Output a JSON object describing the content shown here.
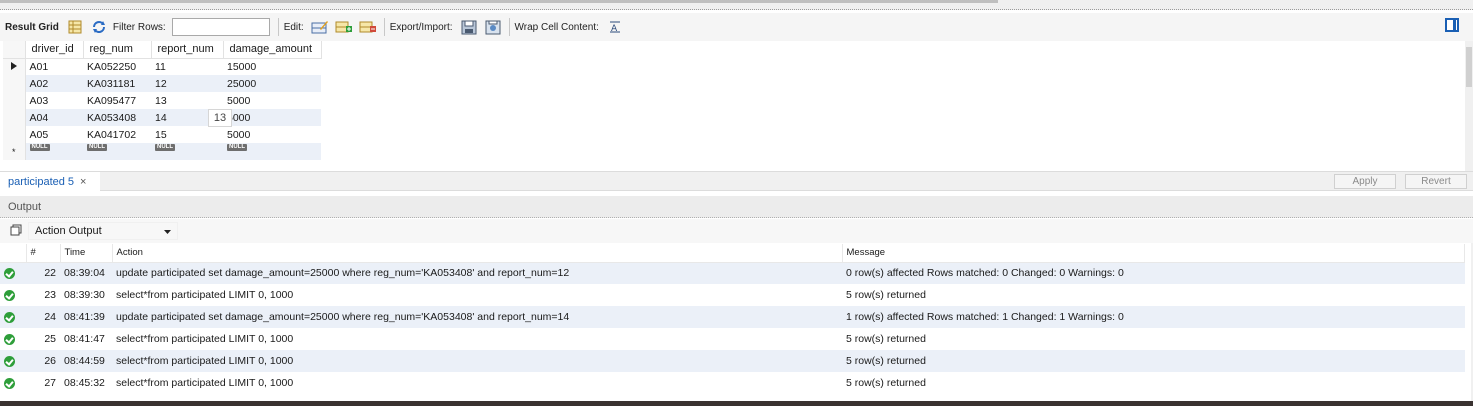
{
  "toolbar": {
    "result_grid_label": "Result Grid",
    "filter_rows_label": "Filter Rows:",
    "filter_rows_value": "",
    "edit_label": "Edit:",
    "export_import_label": "Export/Import:",
    "wrap_cell_label": "Wrap Cell Content:"
  },
  "grid": {
    "columns": [
      "driver_id",
      "reg_num",
      "report_num",
      "damage_amount"
    ],
    "rows": [
      {
        "driver_id": "A01",
        "reg_num": "KA052250",
        "report_num": "11",
        "damage_amount": "15000"
      },
      {
        "driver_id": "A02",
        "reg_num": "KA031181",
        "report_num": "12",
        "damage_amount": "25000"
      },
      {
        "driver_id": "A03",
        "reg_num": "KA095477",
        "report_num": "13",
        "damage_amount": "5000"
      },
      {
        "driver_id": "A04",
        "reg_num": "KA053408",
        "report_num": "14",
        "damage_amount": "5000"
      },
      {
        "driver_id": "A05",
        "reg_num": "KA041702",
        "report_num": "15",
        "damage_amount": "5000"
      }
    ],
    "null_label": "NULL",
    "new_row_marker": "*",
    "tooltip_value": "13"
  },
  "tab": {
    "label": "participated 5",
    "close": "×"
  },
  "buttons": {
    "apply": "Apply",
    "revert": "Revert"
  },
  "output": {
    "title": "Output",
    "selector_value": "Action Output",
    "columns": {
      "num": "#",
      "time": "Time",
      "action": "Action",
      "message": "Message"
    },
    "rows": [
      {
        "num": "22",
        "time": "08:39:04",
        "action": "update participated set damage_amount=25000 where reg_num='KA053408' and report_num=12",
        "message": "0 row(s) affected Rows matched: 0  Changed: 0  Warnings: 0"
      },
      {
        "num": "23",
        "time": "08:39:30",
        "action": "select*from participated LIMIT 0, 1000",
        "message": "5 row(s) returned"
      },
      {
        "num": "24",
        "time": "08:41:39",
        "action": "update participated set damage_amount=25000 where reg_num='KA053408' and report_num=14",
        "message": "1 row(s) affected Rows matched: 1  Changed: 1  Warnings: 0"
      },
      {
        "num": "25",
        "time": "08:41:47",
        "action": "select*from participated LIMIT 0, 1000",
        "message": "5 row(s) returned"
      },
      {
        "num": "26",
        "time": "08:44:59",
        "action": "select*from participated LIMIT 0, 1000",
        "message": "5 row(s) returned"
      },
      {
        "num": "27",
        "time": "08:45:32",
        "action": "select*from participated LIMIT 0, 1000",
        "message": "5 row(s) returned"
      }
    ]
  },
  "colors": {
    "accent": "#1a5fb4",
    "row_alt": "#ebf0f8",
    "success": "#2e9e3a"
  }
}
